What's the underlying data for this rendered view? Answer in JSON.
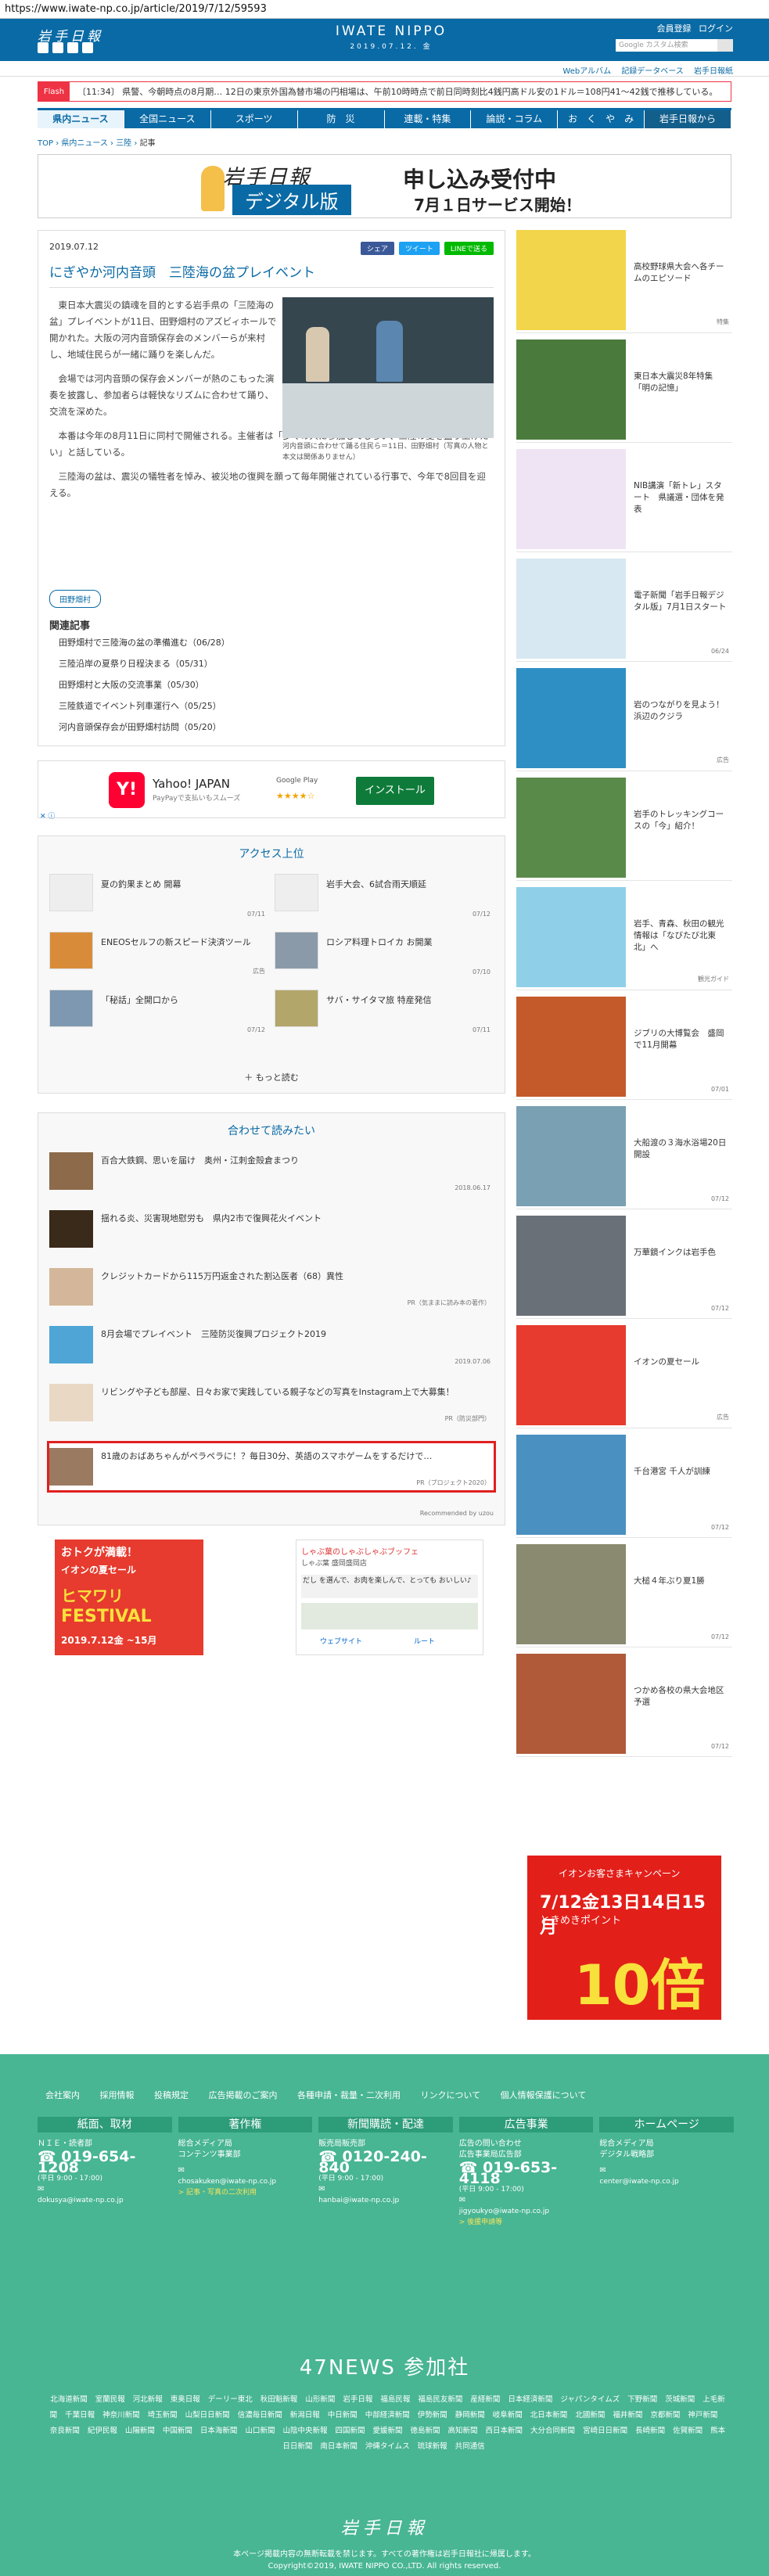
{
  "url": "https://www.iwate-np.co.jp/article/2019/7/12/59593",
  "header": {
    "logo": "岩手日報",
    "brand": "IWATE NIPPO",
    "date": "2019.07.12. 金",
    "right_links": [
      "会員登録",
      "ログイン"
    ],
    "search_placeholder": "Google カスタム検索",
    "sub_links": [
      "Webアルバム",
      "記録データベース",
      "岩手日報紙"
    ]
  },
  "flash": {
    "tag": "Flash",
    "text": "〔11:34〕 県警、今朝時点の8月期… 12日の東京外国為替市場の円相場は、午前10時時点で前日同時刻比4銭円高ドル安の1ドル＝108円41〜42銭で推移している。"
  },
  "nav": [
    "県内ニュース",
    "全国ニュース",
    "スポーツ",
    "防　災",
    "連載・特集",
    "論説・コラム",
    "お　く　や　み",
    "岩手日報から"
  ],
  "breadcrumb": {
    "items": [
      "TOP",
      "県内ニュース",
      "三陸"
    ],
    "current": "記事"
  },
  "banner": {
    "logo": "岩手日報",
    "digital": "デジタル版",
    "title": "申し込み受付中",
    "sub": "7月１日サービス開始！"
  },
  "article": {
    "date": "2019.07.12",
    "share": [
      "シェア",
      "ツイート",
      "LINEで送る"
    ],
    "title": "にぎやか河内音頭　三陸海の盆プレイベント",
    "caption": "河内音頭に合わせて踊る住民ら＝11日、田野畑村（写真の人物と本文は関係ありません）",
    "paras": [
      "東日本大震災の鎮魂を目的とする岩手県の「三陸海の盆」プレイベントが11日、田野畑村のアズビィホールで開かれた。大阪の河内音頭保存会のメンバーらが来村し、地域住民らが一緒に踊りを楽しんだ。",
      "会場では河内音頭の保存会メンバーが熱のこもった演奏を披露し、参加者らは軽快なリズムに合わせて踊り、交流を深めた。",
      "本番は今年の8月11日に同村で開催される。主催者は「多くの人に参加してもらい、三陸の夏を盛り上げたい」と話している。",
      "三陸海の盆は、震災の犠牲者を悼み、被災地の復興を願って毎年開催されている行事で、今年で8回目を迎える。"
    ],
    "tag": "田野畑村",
    "related_heading": "関連記事",
    "related": [
      "田野畑村で三陸海の盆の準備進む（06/28）",
      "三陸沿岸の夏祭り日程決まる（05/31）",
      "田野畑村と大阪の交流事業（05/30）",
      "三陸鉄道でイベント列車運行へ（05/25）",
      "河内音頭保存会が田野畑村訪問（05/20）"
    ]
  },
  "ad_yahoo": {
    "title": "Yahoo! JAPAN",
    "sub": "PayPayで支払いもスムーズ",
    "store": "Google Play",
    "stars": "★★★★☆",
    "install": "インストール"
  },
  "ranking": {
    "title": "アクセス上位",
    "items": [
      {
        "t": "夏の釣果まとめ 開幕",
        "d": "07/11"
      },
      {
        "t": "岩手大会、6試合雨天順延",
        "d": "07/12"
      },
      {
        "t": "ENEOSセルフの新スピード決済ツール",
        "d": "広告"
      },
      {
        "t": "ロシア料理トロイカ お開業",
        "d": "07/10"
      },
      {
        "t": "「秘話」全開口から",
        "d": "07/12"
      },
      {
        "t": "サバ・サイタマ旅 特産発信",
        "d": "07/11"
      }
    ],
    "more": "もっと読む"
  },
  "recommend": {
    "title": "合わせて読みたい",
    "items": [
      {
        "t": "百合大鉄鋼、思いを届け　奥州・江刺金殻倉まつり",
        "d": "2018.06.17"
      },
      {
        "t": "揺れる炎、災害現地慰労も　県内2市で復興花火イベント",
        "d": ""
      },
      {
        "t": "クレジットカードから115万円返金された割込医者（68）異性",
        "d": "PR（気ままに読み本の著作）"
      },
      {
        "t": "8月会場でプレイベント　三陸防災復興プロジェクト2019",
        "d": "2019.07.06"
      },
      {
        "t": "リビングや子ども部屋、日々お家で実践している親子などの写真をInstagram上で大募集！",
        "d": "PR（防災部門）"
      },
      {
        "t": "81歳のおばあちゃんがペラペラに！？毎日30分、英語のスマホゲームをするだけで…",
        "d": "PR（プロジェクト2020）"
      }
    ],
    "by": "Recommended by uzou"
  },
  "aeon_ad": {
    "a1": "おトクが満載！",
    "a2": "イオンの夏セール",
    "a3": "ヒマワリ",
    "a4": "FESTIVAL",
    "a5": "2019.7.12金 ~15月"
  },
  "map_ad": {
    "m1": "しゃぶ葉のしゃぶしゃぶブッフェ",
    "m2": "しゃぶ葉 盛岡盛岡店",
    "m3": "だし を選んで、お肉を楽しんで、とっても おいしい♪",
    "m5": "ウェブサイト",
    "m6": "ルート"
  },
  "side": [
    {
      "t": "高校野球県大会へ各チームのエピソード",
      "d": "特集"
    },
    {
      "t": "東日本大震災8年特集「明の記憶」",
      "d": ""
    },
    {
      "t": "NIB講演「新トレ」スタート　県議選・団体を発表",
      "d": ""
    },
    {
      "t": "電子新聞「岩手日報デジタル版」7月1日スタート",
      "d": "06/24"
    },
    {
      "t": "岩のつながりを見よう！浜辺のクジラ",
      "d": "広告"
    },
    {
      "t": "岩手のトレッキングコースの「今」紹介！",
      "d": ""
    },
    {
      "t": "岩手、青森、秋田の観光情報は「なびたび北東北」へ",
      "d": "観光ガイド"
    },
    {
      "t": "ジブリの大博覧会　盛岡で11月開幕",
      "d": "07/01"
    },
    {
      "t": "大船渡の３海水浴場20日開設",
      "d": "07/12"
    },
    {
      "t": "万華鏡インクは岩手色",
      "d": "07/12"
    },
    {
      "t": "イオンの夏セール",
      "d": "広告"
    },
    {
      "t": "千台港宮 千人が訓練",
      "d": "07/12"
    },
    {
      "t": "大槌４年ぶり夏1勝",
      "d": "07/12"
    },
    {
      "t": "つかめ各校の県大会地区予選",
      "d": "07/12"
    }
  ],
  "side_ad": {
    "s1": "イオンお客さまキャンペーン",
    "s2": "7/12金13日14日15月",
    "s3": "ときめきポイント",
    "s4": "10倍"
  },
  "footer": {
    "links": [
      "会社案内",
      "採用情報",
      "投稿規定",
      "広告掲載のご案内",
      "各種申請・裁量・二次利用",
      "リンクについて",
      "個人情報保護について"
    ],
    "cols": [
      {
        "h": "紙面、取材",
        "l1": "ＮＩＥ・読者部",
        "tel": "019-654-1208",
        "hours": "(平日 9:00 - 17:00)",
        "mail": "dokusya@iwate-np.co.jp"
      },
      {
        "h": "著作権",
        "l1": "総合メディア局\nコンテンツ事業部",
        "tel": "",
        "hours": "",
        "mail": "chosakuken@iwate-np.co.jp",
        "extra": "> 記事・写真の二次利用"
      },
      {
        "h": "新聞購読・配達",
        "l1": "販売局販売部",
        "tel": "0120-240-840",
        "hours": "(平日 9:00 - 17:00)",
        "mail": "hanbai@iwate-np.co.jp"
      },
      {
        "h": "広告事業",
        "l1": "広告の問い合わせ\n広告事業局広告部",
        "tel": "019-653-4118",
        "hours": "(平日 9:00 - 17:00)",
        "mail": "jigyoukyo@iwate-np.co.jp",
        "extra": "> 後援申請等"
      },
      {
        "h": "ホームページ",
        "l1": "総合メディア局\nデジタル戦略部",
        "tel": "",
        "hours": "",
        "mail": "center@iwate-np.co.jp"
      }
    ],
    "f47": "47NEWS 参加社",
    "f47list": [
      "北海道新聞",
      "室蘭民報",
      "河北新報",
      "東奥日報",
      "デーリー東北",
      "秋田魁新報",
      "山形新聞",
      "岩手日報",
      "福島民報",
      "福島民友新聞",
      "産経新聞",
      "日本経済新聞",
      "ジャパンタイムズ",
      "下野新聞",
      "茨城新聞",
      "上毛新聞",
      "千葉日報",
      "神奈川新聞",
      "埼玉新聞",
      "山梨日日新聞",
      "信濃毎日新聞",
      "新潟日報",
      "中日新聞",
      "中部経済新聞",
      "伊勢新聞",
      "静岡新聞",
      "岐阜新聞",
      "北日本新聞",
      "北國新聞",
      "福井新聞",
      "京都新聞",
      "神戸新聞",
      "奈良新聞",
      "紀伊民報",
      "山陽新聞",
      "中国新聞",
      "日本海新聞",
      "山口新聞",
      "山陰中央新報",
      "四国新聞",
      "愛媛新聞",
      "徳島新聞",
      "高知新聞",
      "西日本新聞",
      "大分合同新聞",
      "宮崎日日新聞",
      "長崎新聞",
      "佐賀新聞",
      "熊本日日新聞",
      "南日本新聞",
      "沖縄タイムス",
      "琉球新報",
      "共同通信"
    ],
    "flogo": "岩手日報",
    "fnote": "本ページ掲載内容の無断転載を禁じます。すべての著作権は岩手日報社に帰属します。",
    "copy": "Copyright©2019, IWATE NIPPO CO.,LTD. All rights reserved."
  }
}
